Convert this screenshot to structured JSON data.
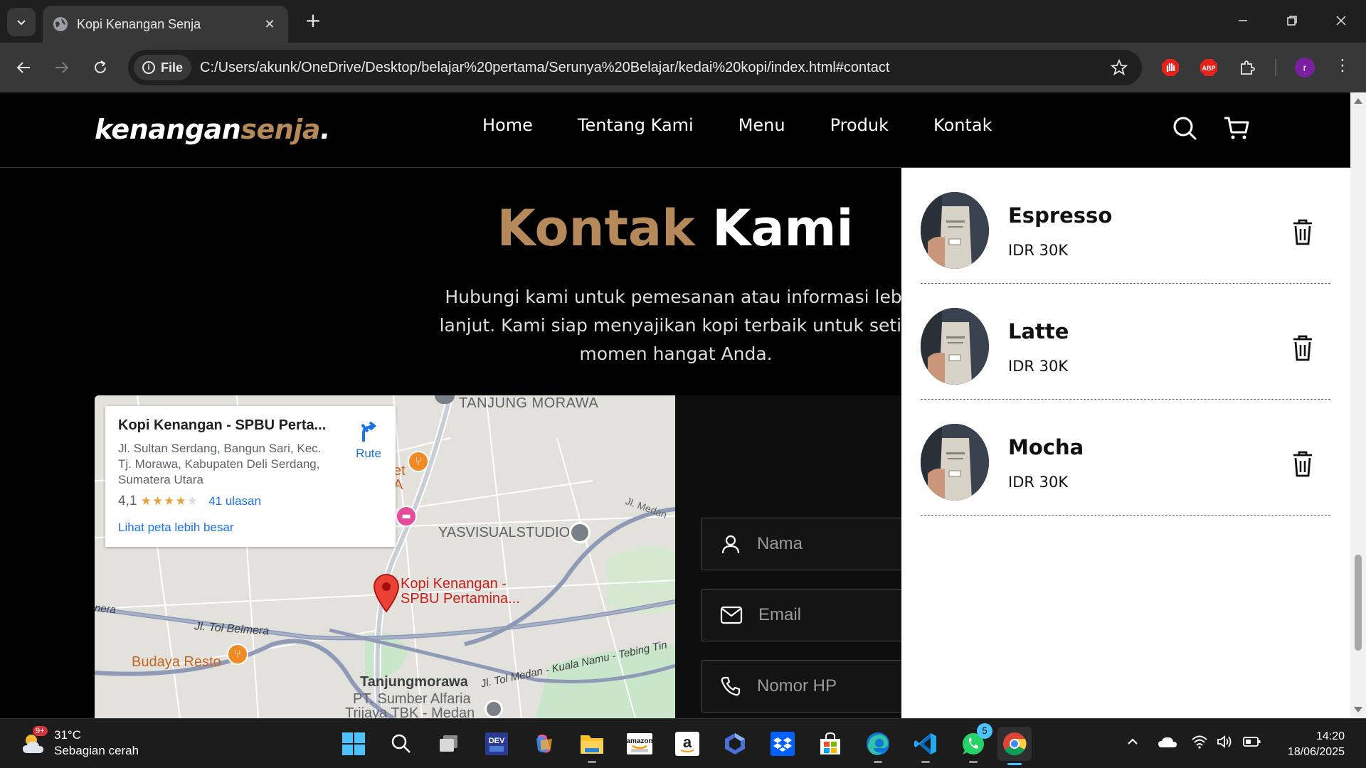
{
  "browser": {
    "tab_title": "Kopi Kenangan Senja",
    "site_chip": "File",
    "url": "C:/Users/akunk/OneDrive/Desktop/belajar%20pertama/Serunya%20Belajar/kedai%20kopi/index.html#contact",
    "profile_initial": "r",
    "icons": [
      "tab-search-icon",
      "globe-icon",
      "close-icon",
      "plus-icon",
      "minimize-icon",
      "restore-icon",
      "window-close-icon",
      "back-icon",
      "forward-icon",
      "reload-icon",
      "bookmark-star-icon",
      "extension-stop-icon",
      "adblock-icon",
      "puzzle-icon",
      "kebab-menu-icon"
    ]
  },
  "site": {
    "logo_main": "kenangan",
    "logo_accent": "senja",
    "logo_dot": ".",
    "nav": [
      "Home",
      "Tentang Kami",
      "Menu",
      "Produk",
      "Kontak"
    ],
    "heading_accent": "Kontak",
    "heading_rest": " Kami",
    "subtext_lines": [
      "Hubungi kami untuk pemesanan atau informasi lebi",
      "lanjut. Kami siap menyajikan kopi terbaik untuk setia",
      "momen hangat Anda."
    ],
    "accent_color": "#b6895b"
  },
  "map": {
    "place_name": "Kopi Kenangan - SPBU Perta...",
    "address": "Jl. Sultan Serdang, Bangun Sari, Kec. Tj. Morawa, Kabupaten Deli Serdang, Sumatera Utara",
    "rating": "4,1",
    "stars": "★★★★",
    "star_empty": "★",
    "reviews": "41 ulasan",
    "route_label": "Rute",
    "larger_map": "Lihat peta lebih besar",
    "labels": {
      "tanjung_morawa_top": "TANJUNG MORAWA",
      "yasvisual": "YASVISUALSTUDIO",
      "pin_line1": "Kopi Kenangan -",
      "pin_line2": "SPBU Pertamina...",
      "jl_medan": "Jl. Medan",
      "jl_tol_belmera": "Jl. Tol Belmera",
      "belmera_left": "nera",
      "budaya": "Budaya Resto",
      "tanjungmorawa": "Tanjungmorawa",
      "jl_tol_medan": "Jl. Tol Medan - Kuala Namu - Tebing Tin",
      "sumber_alfaria": "PT. Sumber Alfaria",
      "trijaya": "Trijaya TBK - Medan",
      "et": "et",
      "a": "A"
    }
  },
  "form": {
    "name_placeholder": "Nama",
    "email_placeholder": "Email",
    "phone_placeholder": "Nomor HP"
  },
  "cart": {
    "items": [
      {
        "name": "Espresso",
        "price": "IDR 30K"
      },
      {
        "name": "Latte",
        "price": "IDR 30K"
      },
      {
        "name": "Mocha",
        "price": "IDR 30K"
      }
    ]
  },
  "taskbar": {
    "weather_temp": "31°C",
    "weather_desc": "Sebagian cerah",
    "weather_badge": "9+",
    "whatsapp_badge": "5",
    "time": "14:20",
    "date": "18/06/2025",
    "dev_label": "DEV",
    "amazon_label": "amazon"
  }
}
